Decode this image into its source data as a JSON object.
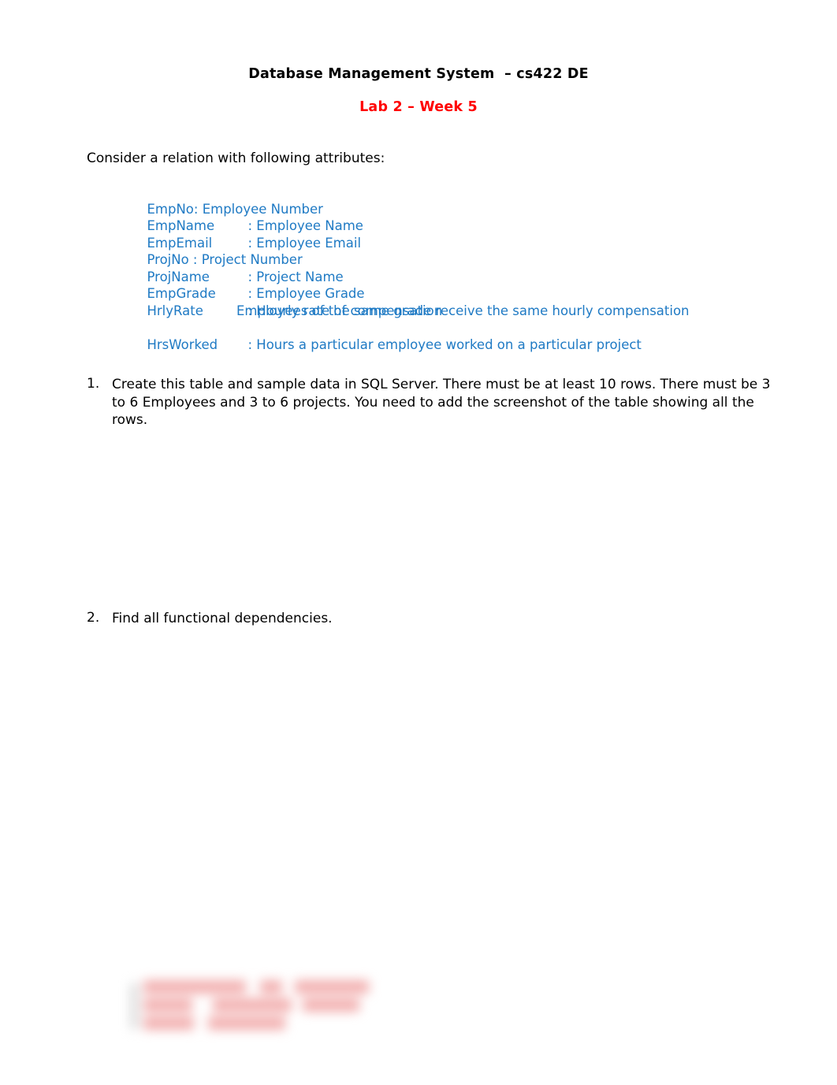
{
  "document": {
    "title": "Database Management System  – cs422 DE",
    "subtitle": "Lab 2 – Week 5",
    "intro": "Consider a relation with following attributes:",
    "attributes": [
      {
        "name": "EmpNo:",
        "desc": " Employee Number",
        "inline": true
      },
      {
        "name": "EmpName",
        "desc": ": Employee Name",
        "inline": false
      },
      {
        "name": "EmpEmail",
        "desc": ": Employee Email",
        "inline": false
      },
      {
        "name": "ProjNo :",
        "desc": " Project Number",
        "inline": true
      },
      {
        "name": "ProjName",
        "desc": ": Project Name",
        "inline": false
      },
      {
        "name": "EmpGrade",
        "desc": ": Employee Grade",
        "inline": false
      },
      {
        "name": "HrlyRate",
        "desc": ": Hourly rate of compensation",
        "inline": false
      }
    ],
    "attribute_continuation": "Employees of the same grade receive the same hourly compensation",
    "attribute_last": {
      "name": "HrsWorked",
      "desc": ": Hours a particular employee worked on a particular project",
      "inline": false
    },
    "items": [
      {
        "marker": "1.",
        "text": "Create this table and sample data in SQL Server. There must be at least 10 rows. There must be 3 to 6 Employees and 3 to 6 projects. You need to add the screenshot of the table showing all the rows."
      },
      {
        "marker": "2.",
        "text": "Find all functional dependencies."
      }
    ],
    "footer_watermark": {
      "description": "blurred-redacted-red-text",
      "color": "#f2b0b0"
    }
  }
}
